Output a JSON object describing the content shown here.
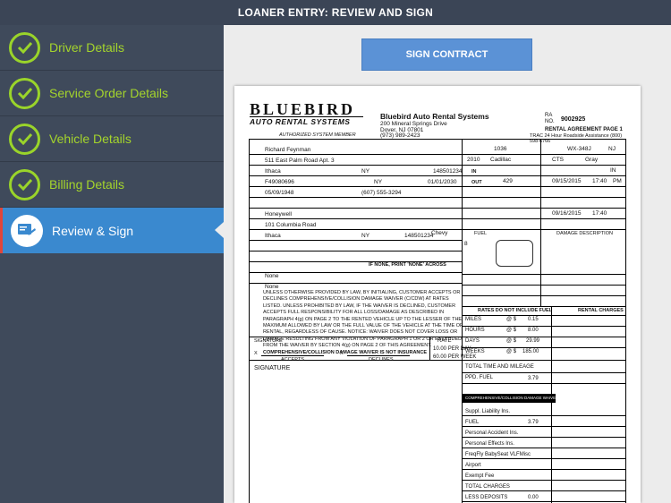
{
  "header": {
    "title": "LOANER ENTRY:  REVIEW AND SIGN"
  },
  "sidebar": {
    "items": [
      {
        "label": "Driver Details",
        "icon": "check-icon"
      },
      {
        "label": "Service Order Details",
        "icon": "check-icon"
      },
      {
        "label": "Vehicle Details",
        "icon": "check-icon"
      },
      {
        "label": "Billing Details",
        "icon": "check-icon"
      },
      {
        "label": "Review & Sign",
        "icon": "review-sign-icon"
      }
    ]
  },
  "sign_button": {
    "label": "SIGN CONTRACT"
  },
  "colors": {
    "accent": "#3a89cf",
    "check": "#9ad42a",
    "sidebar": "#3f4a5b"
  },
  "contract": {
    "logo_line1": "BLUEBIRD",
    "logo_line2": "AUTO RENTAL SYSTEMS",
    "authorized": "AUTHORIZED SYSTEM MEMBER",
    "company": "Bluebird Auto Rental Systems",
    "address1": "200 Mineral Springs Drive",
    "address2": "Dover, NJ  07801",
    "phone": "(973) 989-2423",
    "ra_label": "RA",
    "no_label": "NO.",
    "ra_number": "9002925",
    "page_label": "RENTAL AGREEMENT PAGE 1",
    "roadside": "TRAC 24 Hour Roadside Assistance (800) 598-6766",
    "renter_name": "Richard Feynman",
    "home_address": "511 East Palm Road Apt. 3",
    "city": "Ithaca",
    "state": "NY",
    "zip": "148501234",
    "license": "F49080696",
    "license_state": "NY",
    "license_expires": "01/01/2030",
    "birth_date": "05/09/1948",
    "home_phone": "(607) 555-3294",
    "employer": "Honeywell",
    "employer_address": "101 Columbia Road",
    "employer_city": "Ithaca",
    "employer_state": "NY",
    "employer_zip": "148501234",
    "referred_by": "Chevy",
    "vehicle_number": "1036",
    "vehicle_year": "2010",
    "vehicle_make": "Cadillac",
    "vehicle_model": "CTS",
    "vehicle_color": "Gray",
    "license_number": "WX-348J",
    "license_plate_state": "NJ",
    "mileage_in": "IN",
    "mileage_out": "OUT",
    "mileage_out_value": "429",
    "date_out": "09/15/2015",
    "time_out": "17:40",
    "time_out_suffix": "PM",
    "date_due": "09/16/2015",
    "time_due": "17:40",
    "fuel_out": "8",
    "additional_driver": "None",
    "additional_driver2": "None",
    "no_additional": "IF NONE, PRINT 'NONE' ACROSS",
    "cdw_text": "UNLESS OTHERWISE PROVIDED BY LAW, BY INITIALING, CUSTOMER ACCEPTS OR DECLINES COMPREHENSIVE/COLLISION DAMAGE WAIVER (C/CDW) AT RATES LISTED. UNLESS PROHIBITED BY LAW, IF THE WAIVER IS DECLINED, CUSTOMER ACCEPTS FULL RESPONSIBILITY FOR ALL LOSS/DAMAGE AS DESCRIBED IN PARAGRAPH 4(g) ON PAGE 2 TO THE RENTED VEHICLE UP TO THE LESSER OF THE MAXIMUM ALLOWED BY LAW OR THE FULL VALUE OF THE VEHICLE AT THE TIME OF RENTAL, REGARDLESS OF CAUSE. NOTICE: WAIVER DOES NOT COVER LOSS OR DAMAGE RESULTING FROM ANY VIOLATION OF PARAGRAPH 1 OR 2 OR EXCLUDED FROM THE WAIVER BY SECTION 4(g) ON PAGE 2 OF THIS AGREEMENT.",
    "cdw_bold": "COMPREHENSIVE/COLLISION DAMAGE WAIVER IS NOT INSURANCE",
    "signature_label": "SIGNATURE",
    "accepts": "ACCEPTS",
    "declines": "DECLINES",
    "rate_label": "RATE",
    "rate_day": "10.00",
    "rate_day_label": "PER DAY",
    "rate_week": "60.00",
    "rate_week_label": "PER WEEK",
    "rates_header": "RATES DO NOT INCLUDE FUEL",
    "charges_header": "RENTAL CHARGES",
    "rates": [
      {
        "label": "MILES",
        "at": "@ $",
        "value": "0.15"
      },
      {
        "label": "HOURS",
        "at": "@ $",
        "value": "8.00"
      },
      {
        "label": "DAYS",
        "at": "@ $",
        "value": "29.99"
      },
      {
        "label": "WEEKS",
        "at": "@ $",
        "value": "185.00"
      }
    ],
    "time_mileage": "TOTAL TIME AND MILEAGE",
    "ppd_fuel": "PPD. FUEL",
    "ppd_fuel_value": "3.79",
    "cdw_row": "COMPREHENSIVE/COLLISION DAMAGE WAIVER",
    "charges": [
      {
        "label": "Suppl. Liability Ins.",
        "value": ""
      },
      {
        "label": "FUEL",
        "value": "3.79"
      },
      {
        "label": "Personal Accident Ins.",
        "value": ""
      },
      {
        "label": "Personal Effects Ins.",
        "value": ""
      },
      {
        "label": "FreqFly BabySeat VLFMisc",
        "value": ""
      },
      {
        "label": "Airport",
        "value": ""
      },
      {
        "label": "Exempt Fee",
        "value": ""
      },
      {
        "label": "TOTAL CHARGES",
        "value": ""
      },
      {
        "label": "LESS DEPOSITS",
        "value": "0.00"
      }
    ],
    "damage_desc": "DAMAGE DESCRIPTION",
    "fuel_label": "FUEL"
  }
}
